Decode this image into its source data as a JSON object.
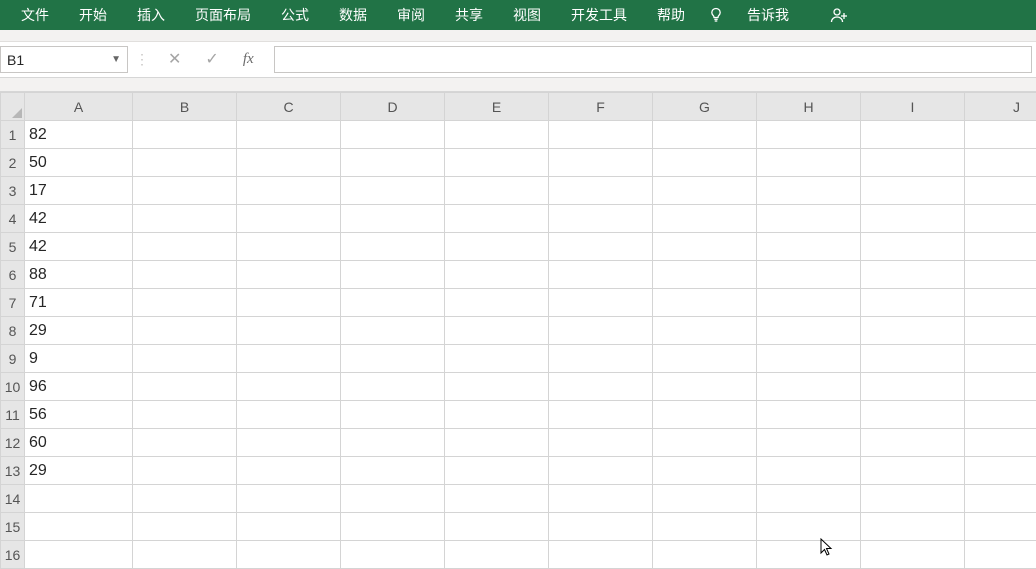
{
  "ribbon": {
    "tabs": [
      "文件",
      "开始",
      "插入",
      "页面布局",
      "公式",
      "数据",
      "审阅",
      "共享",
      "视图",
      "开发工具",
      "帮助"
    ],
    "tell_me": "告诉我"
  },
  "formula_bar": {
    "name_box": "B1",
    "fx_label": "fx",
    "cancel_icon": "✕",
    "enter_icon": "✓",
    "formula_value": ""
  },
  "grid": {
    "columns": [
      "A",
      "B",
      "C",
      "D",
      "E",
      "F",
      "G",
      "H",
      "I",
      "J"
    ],
    "row_count": 16,
    "cells": {
      "A1": "82",
      "A2": "50",
      "A3": "17",
      "A4": "42",
      "A5": "42",
      "A6": "88",
      "A7": "71",
      "A8": "29",
      "A9": "9",
      "A10": "96",
      "A11": "56",
      "A12": "60",
      "A13": "29"
    }
  }
}
